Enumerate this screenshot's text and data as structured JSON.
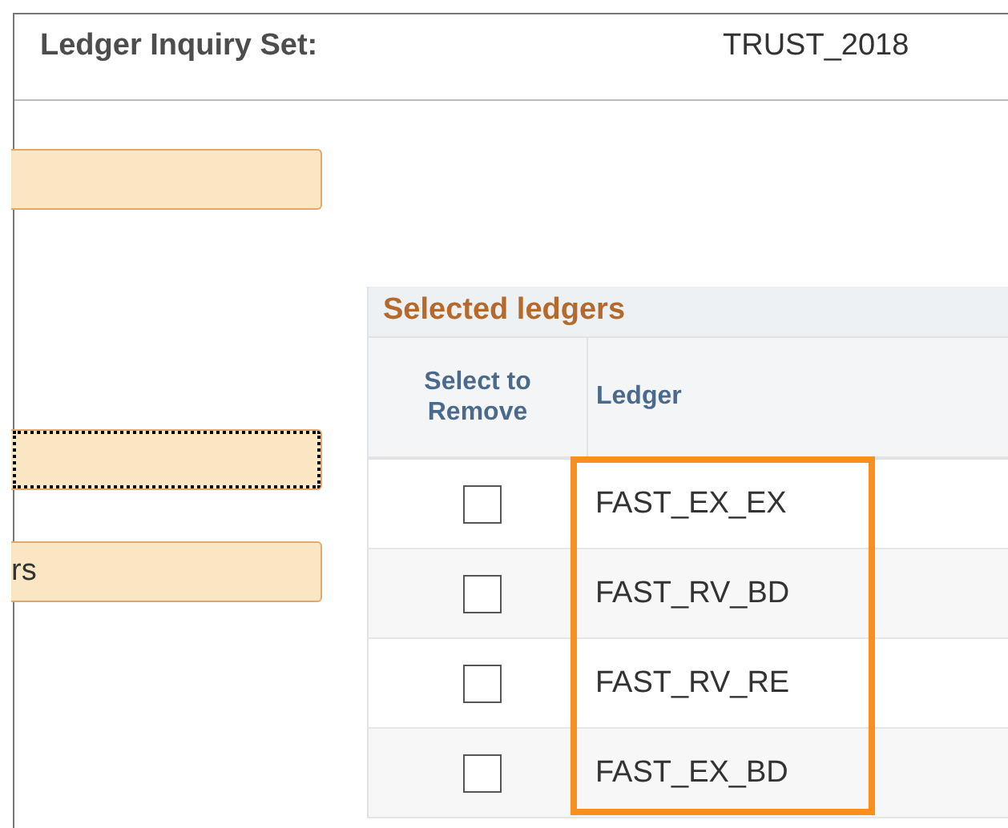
{
  "header": {
    "label": "Ledger Inquiry Set:",
    "value": "TRUST_2018"
  },
  "buttons": [
    {
      "focused": false
    },
    {
      "focused": true
    },
    {
      "label": "rs",
      "focused": false
    }
  ],
  "table": {
    "title": "Selected ledgers",
    "columns": [
      "Select to Remove",
      "Ledger"
    ],
    "highlight_ledger_column": true,
    "rows": [
      {
        "checked": false,
        "ledger": "FAST_EX_EX"
      },
      {
        "checked": false,
        "ledger": "FAST_RV_BD"
      },
      {
        "checked": false,
        "ledger": "FAST_RV_RE"
      },
      {
        "checked": false,
        "ledger": "FAST_EX_BD"
      }
    ]
  }
}
